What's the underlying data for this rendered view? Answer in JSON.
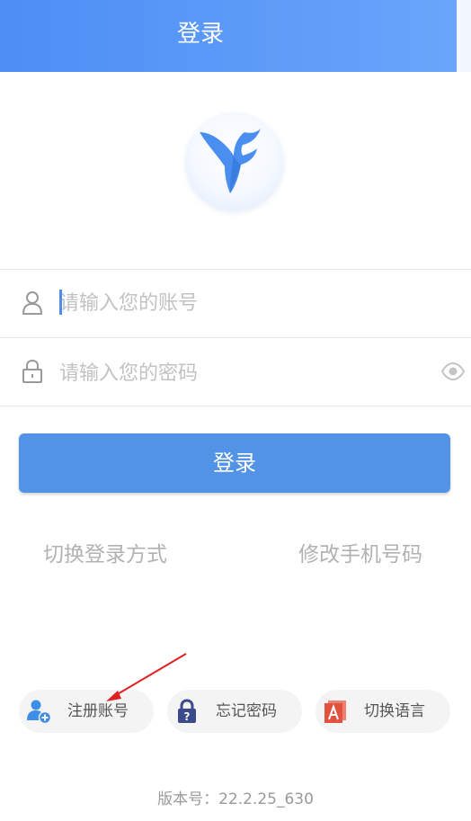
{
  "header": {
    "title": "登录"
  },
  "login_form": {
    "account_placeholder": "请输入您的账号",
    "password_placeholder": "请输入您的密码",
    "login_button": "登录"
  },
  "links": {
    "switch_login_method": "切换登录方式",
    "change_phone": "修改手机号码"
  },
  "actions": {
    "register": "注册账号",
    "forgot_password": "忘记密码",
    "switch_language": "切换语言"
  },
  "footer": {
    "version": "版本号：22.2.25_630"
  },
  "colors": {
    "header_start": "#4e8ef5",
    "header_end": "#6aa6fb",
    "primary_button": "#5393e6",
    "annotation_arrow": "#e02020"
  },
  "icons": {
    "logo": "feather-logo-icon",
    "account": "user-icon",
    "password": "lock-icon",
    "visibility": "eye-icon",
    "register": "add-user-icon",
    "forgot": "padlock-question-icon",
    "language": "language-a-icon"
  }
}
